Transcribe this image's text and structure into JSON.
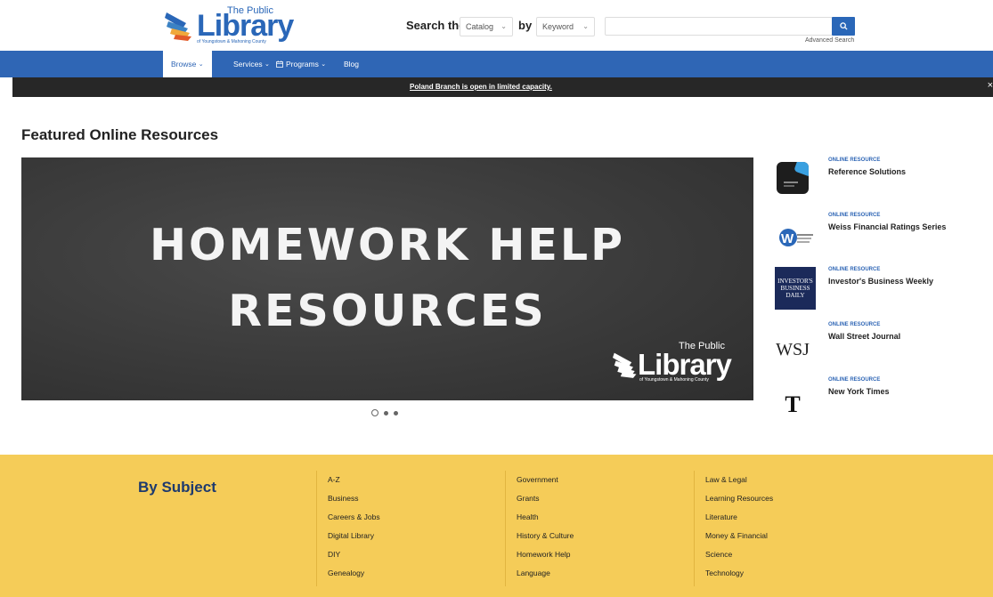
{
  "logo": {
    "the_public": "The Public",
    "library": "Library",
    "subtitle": "of Youngstown & Mahoning County"
  },
  "search": {
    "label": "Search the",
    "scope_selected": "Catalog",
    "by_label": "by",
    "field_selected": "Keyword",
    "query_value": "",
    "advanced_label": "Advanced Search"
  },
  "nav": {
    "items": [
      {
        "label": "Browse"
      },
      {
        "label": "Services"
      },
      {
        "label": "Programs"
      },
      {
        "label": "Blog"
      }
    ]
  },
  "alert": {
    "text": "Poland Branch is open in limited capacity.",
    "close": "×"
  },
  "featured": {
    "title": "Featured Online Resources",
    "slide": {
      "line1": "HOMEWORK HELP",
      "line2": "RESOURCES"
    },
    "resources": [
      {
        "type": "ONLINE RESOURCE",
        "name": "Reference Solutions",
        "icon": "reference-solutions-logo"
      },
      {
        "type": "ONLINE RESOURCE",
        "name": "Weiss Financial Ratings Series",
        "icon": "weiss-logo"
      },
      {
        "type": "ONLINE RESOURCE",
        "name": "Investor's Business Weekly",
        "icon": "investors-business-daily-logo"
      },
      {
        "type": "ONLINE RESOURCE",
        "name": "Wall Street Journal",
        "icon": "wsj-logo"
      },
      {
        "type": "ONLINE RESOURCE",
        "name": "New York Times",
        "icon": "nyt-logo"
      }
    ],
    "ibd_lines": [
      "INVESTOR'S",
      "BUSINESS",
      "DAILY"
    ],
    "wsj_text": "WSJ",
    "nyt_text": "T"
  },
  "subject": {
    "title": "By Subject",
    "columns": [
      [
        "A-Z",
        "Business",
        "Careers & Jobs",
        "Digital Library",
        "DIY",
        "Genealogy"
      ],
      [
        "Government",
        "Grants",
        "Health",
        "History & Culture",
        "Homework Help",
        "Language"
      ],
      [
        "Law & Legal",
        "Learning Resources",
        "Literature",
        "Money & Financial",
        "Science",
        "Technology"
      ]
    ]
  },
  "colors": {
    "brand_blue": "#2f66b5",
    "alert_bg": "#272727",
    "subject_bg": "#f5cc58"
  }
}
